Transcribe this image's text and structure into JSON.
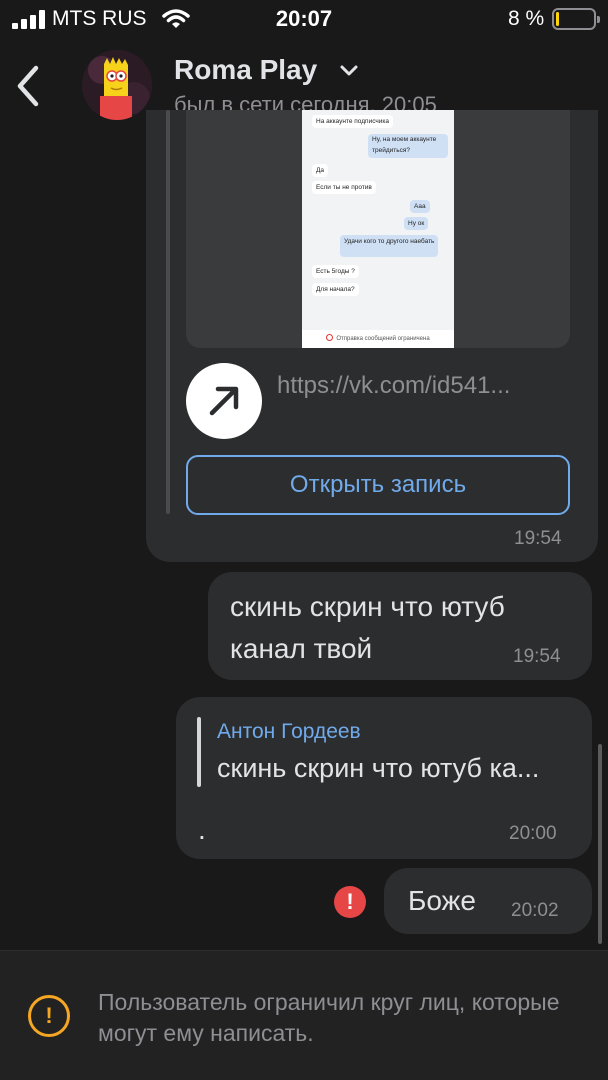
{
  "status_bar": {
    "carrier": "MTS RUS",
    "time": "20:07",
    "battery_percent_label": "8 %",
    "battery_level": 0.08,
    "signal_bars_active": 4
  },
  "header": {
    "name": "Roma Play",
    "status": "был в сети сегодня, 20:05"
  },
  "messages": {
    "post": {
      "screenshot_lines": [
        "На аккаунте подписчика",
        "Ну, на моем аккаунте трейдиться?",
        "Да",
        "Если ты не против",
        "Ааа",
        "Ну ок",
        "Удачи кого то другого наебать",
        "Есть 5годы ?",
        "Для начала?"
      ],
      "screenshot_footer": "Отправка сообщений ограничена",
      "link_url": "https://vk.com/id541...",
      "open_label": "Открыть запись",
      "time": "19:54"
    },
    "msg1": {
      "line1": "скинь скрин что ютуб",
      "line2": "канал твой",
      "time": "19:54"
    },
    "msg2": {
      "reply_author": "Антон Гордеев",
      "reply_text": "скинь скрин что ютуб ка...",
      "body": ".",
      "time": "20:00"
    },
    "msg3": {
      "text": "Боже",
      "time": "20:02",
      "error_mark": "!"
    }
  },
  "notice": {
    "icon_mark": "!",
    "text": "Пользователь ограничил круг лиц, которые могут ему написать."
  },
  "colors": {
    "background": "#19191a",
    "bubble": "#2c2d2e",
    "accent": "#71aaeb",
    "error": "#e64646",
    "warning": "#f5a623",
    "battery": "#ffd60a"
  }
}
